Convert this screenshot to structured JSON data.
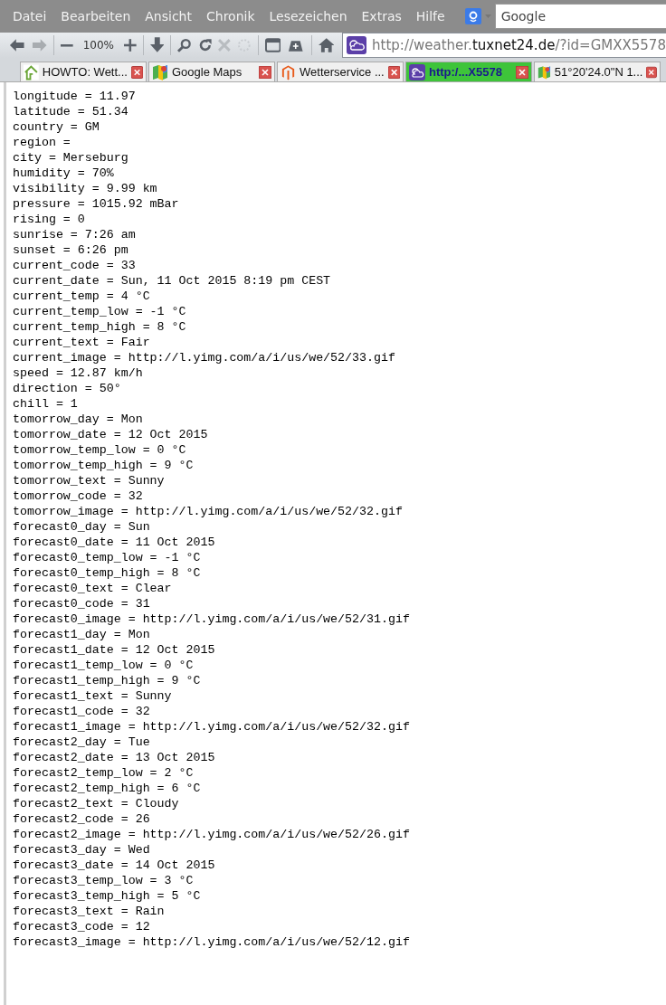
{
  "menu": [
    "Datei",
    "Bearbeiten",
    "Ansicht",
    "Chronik",
    "Lesezeichen",
    "Extras",
    "Hilfe"
  ],
  "search": {
    "placeholder": "Google"
  },
  "toolbar": {
    "zoom": "100%"
  },
  "url": {
    "prefix": "http://weather.",
    "domain": "tuxnet24.de",
    "suffix": "/?id=GMXX5578"
  },
  "tabs": [
    {
      "label": "HOWTO: Wett...",
      "kind": "house",
      "selected": false
    },
    {
      "label": "Google Maps",
      "kind": "maps",
      "selected": false
    },
    {
      "label": "Wetterservice ...",
      "kind": "magento",
      "selected": false
    },
    {
      "label": "http:/...X5578",
      "kind": "weather",
      "selected": true
    },
    {
      "label": "51°20'24.0\"N 1...",
      "kind": "maps",
      "selected": false
    }
  ],
  "lines": [
    "longitude = 11.97",
    "latitude = 51.34",
    "country = GM",
    "region =",
    "city = Merseburg",
    "humidity = 70%",
    "visibility = 9.99 km",
    "pressure = 1015.92 mBar",
    "rising = 0",
    "sunrise = 7:26 am",
    "sunset = 6:26 pm",
    "current_code = 33",
    "current_date = Sun, 11 Oct 2015 8:19 pm CEST",
    "current_temp = 4 °C",
    "current_temp_low = -1 °C",
    "current_temp_high = 8 °C",
    "current_text = Fair",
    "current_image = http://l.yimg.com/a/i/us/we/52/33.gif",
    "speed = 12.87 km/h",
    "direction = 50°",
    "chill = 1",
    "tomorrow_day = Mon",
    "tomorrow_date = 12 Oct 2015",
    "tomorrow_temp_low = 0 °C",
    "tomorrow_temp_high = 9 °C",
    "tomorrow_text = Sunny",
    "tomorrow_code = 32",
    "tomorrow_image = http://l.yimg.com/a/i/us/we/52/32.gif",
    "forecast0_day = Sun",
    "forecast0_date = 11 Oct 2015",
    "forecast0_temp_low = -1 °C",
    "forecast0_temp_high = 8 °C",
    "forecast0_text = Clear",
    "forecast0_code = 31",
    "forecast0_image = http://l.yimg.com/a/i/us/we/52/31.gif",
    "forecast1_day = Mon",
    "forecast1_date = 12 Oct 2015",
    "forecast1_temp_low = 0 °C",
    "forecast1_temp_high = 9 °C",
    "forecast1_text = Sunny",
    "forecast1_code = 32",
    "forecast1_image = http://l.yimg.com/a/i/us/we/52/32.gif",
    "forecast2_day = Tue",
    "forecast2_date = 13 Oct 2015",
    "forecast2_temp_low = 2 °C",
    "forecast2_temp_high = 6 °C",
    "forecast2_text = Cloudy",
    "forecast2_code = 26",
    "forecast2_image = http://l.yimg.com/a/i/us/we/52/26.gif",
    "forecast3_day = Wed",
    "forecast3_date = 14 Oct 2015",
    "forecast3_temp_low = 3 °C",
    "forecast3_temp_high = 5 °C",
    "forecast3_text = Rain",
    "forecast3_code = 12",
    "forecast3_image = http://l.yimg.com/a/i/us/we/52/12.gif"
  ]
}
